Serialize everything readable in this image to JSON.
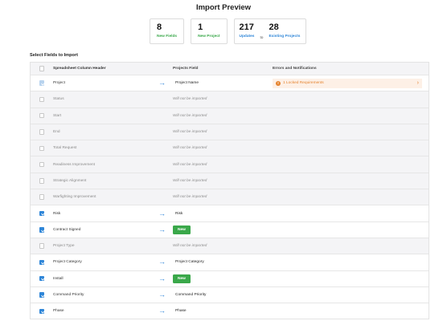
{
  "title": "Import Preview",
  "stats": {
    "new_fields": {
      "num": "8",
      "label": "New Fields"
    },
    "new_project": {
      "num": "1",
      "label": "New Project"
    },
    "updates": {
      "num": "217",
      "label": "Updates"
    },
    "to": "to",
    "existing": {
      "num": "28",
      "label": "Existing Projects"
    }
  },
  "section_title": "Select Fields to Import",
  "table": {
    "headers": {
      "column": "Spreadsheet Column Header",
      "field": "Projects Field",
      "errors": "Errors and Notifications"
    },
    "ignored_text": "Will not be imported",
    "new_text": "New",
    "error_text": "1 Locked Requirements",
    "error_icon": "!",
    "rows": [
      {
        "column": "Project",
        "field": "Project Name"
      },
      {
        "column": "Status"
      },
      {
        "column": "Start"
      },
      {
        "column": "End"
      },
      {
        "column": "Total Request"
      },
      {
        "column": "Readiness Improvement"
      },
      {
        "column": "Strategic Alignment"
      },
      {
        "column": "Warfighting Improvement"
      },
      {
        "column": "Risk",
        "field": "Risk"
      },
      {
        "column": "Contract Signed"
      },
      {
        "column": "Project Type"
      },
      {
        "column": "Project Category",
        "field": "Project Category"
      },
      {
        "column": "Install"
      },
      {
        "column": "Command Priority",
        "field": "Command Priority"
      },
      {
        "column": "Phase",
        "field": "Phase"
      }
    ]
  },
  "colors": {
    "accent": "#2f86d8",
    "success": "#3aa84a",
    "warning": "#e5832e"
  }
}
